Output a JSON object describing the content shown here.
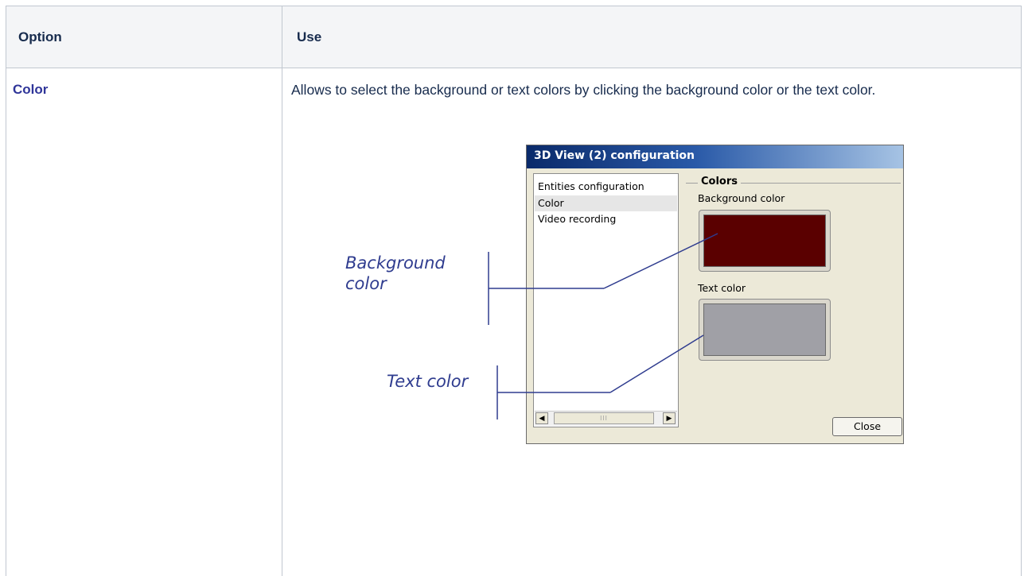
{
  "table": {
    "headers": [
      "Option",
      "Use"
    ],
    "rows": [
      {
        "option": "Color",
        "use": "Allows to select the background or text colors by clicking the background color or the text color."
      }
    ]
  },
  "screenshot": {
    "window_title": "3D View (2) configuration",
    "list_items": [
      "Entities configuration",
      "Color",
      "Video recording"
    ],
    "selected_item": "Color",
    "group_title": "Colors",
    "background_label": "Background color",
    "text_label": "Text color",
    "background_value": "#5a0000",
    "text_value": "#a0a0a6",
    "scroll_left": "◀",
    "scroll_thumb": "III",
    "scroll_right": "▶",
    "close_label": "Close",
    "annotations": {
      "background": "Background color",
      "background_line1": "Background",
      "background_line2": "color",
      "text": "Text color"
    }
  },
  "colors": {
    "header_bg": "#f4f5f7",
    "border": "#c1c7d0",
    "link": "#2f3599",
    "annotation": "#2f3c8f"
  }
}
